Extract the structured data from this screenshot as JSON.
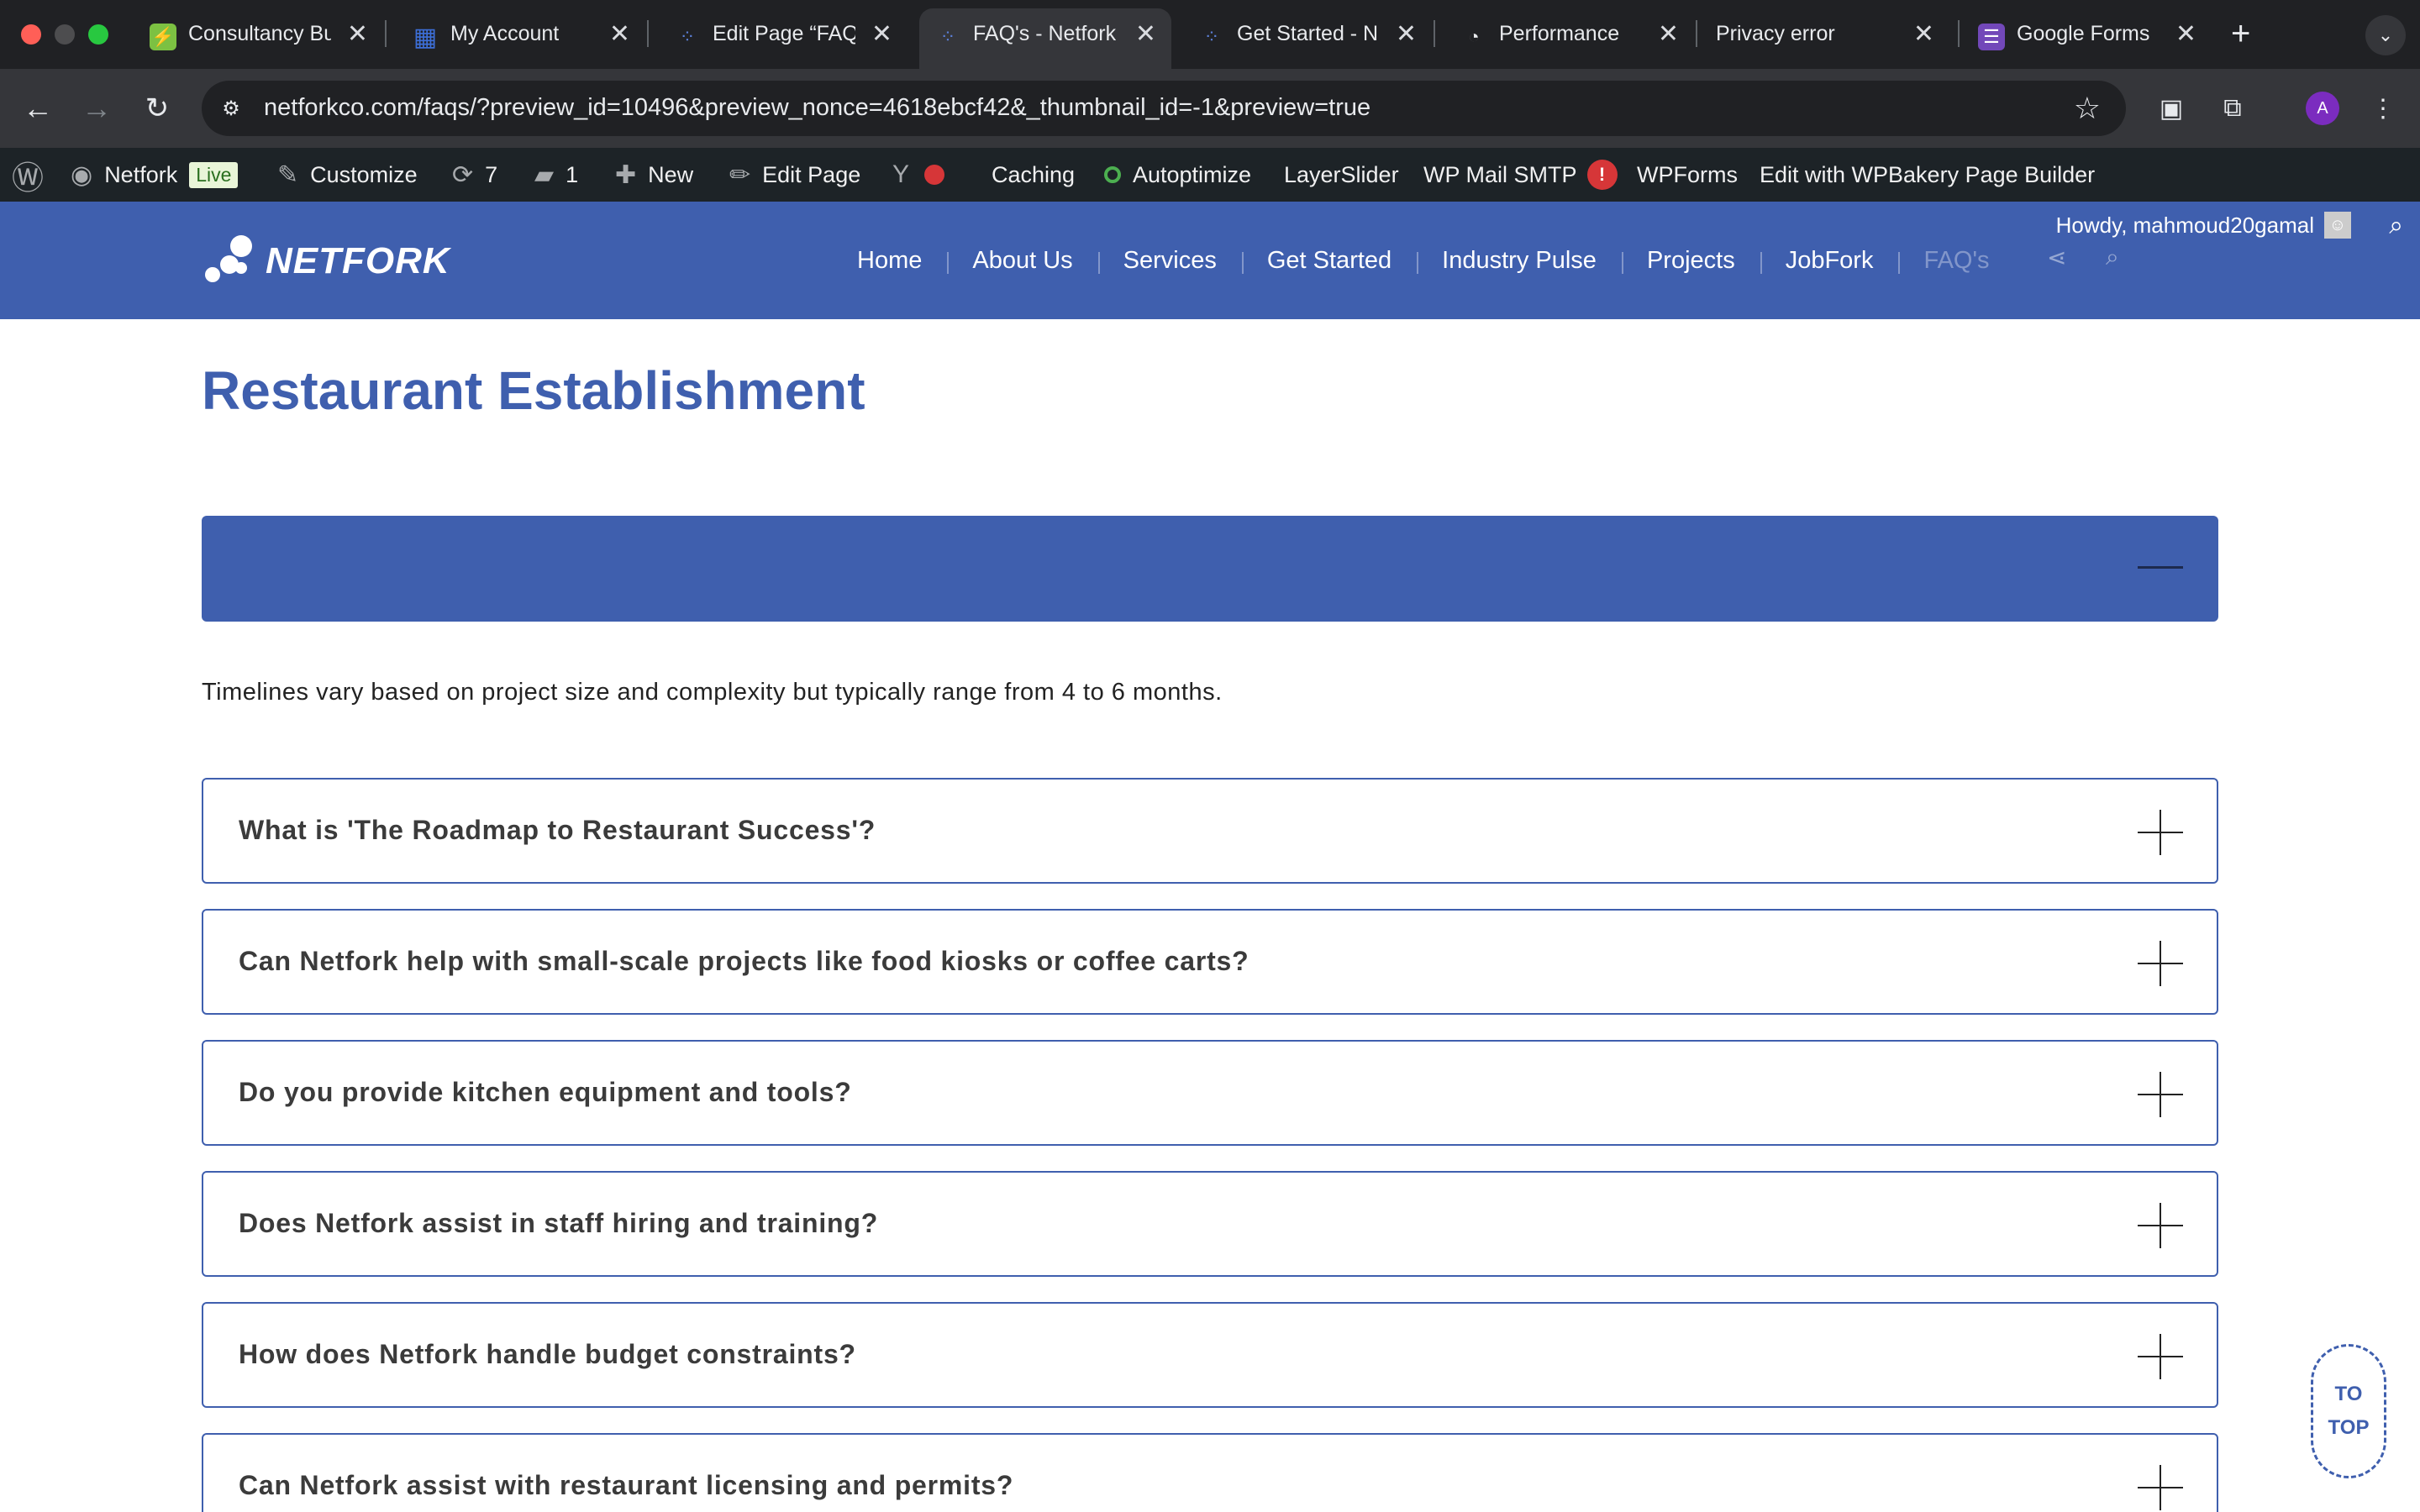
{
  "browser": {
    "tabs": [
      {
        "title": "Consultancy Bu",
        "favicon": "leaf-icon",
        "favicon_color": "#7cc142"
      },
      {
        "title": "My Account",
        "favicon": "grid-icon",
        "favicon_color": "#3d6fd8"
      },
      {
        "title": "Edit Page “FAQ",
        "favicon": "netfork-icon",
        "favicon_color": "#5b7fd6"
      },
      {
        "title": "FAQ's - Netfork",
        "favicon": "netfork-icon",
        "favicon_color": "#5b7fd6",
        "active": true
      },
      {
        "title": "Get Started - N",
        "favicon": "netfork-icon",
        "favicon_color": "#5b7fd6"
      },
      {
        "title": "Performance",
        "favicon": "gauge-icon",
        "favicon_color": "#e8eaed"
      },
      {
        "title": "Privacy error",
        "favicon": "",
        "favicon_color": ""
      },
      {
        "title": "Google Forms",
        "favicon": "forms-icon",
        "favicon_color": "#7248b9"
      }
    ],
    "close_glyph": "✕",
    "new_tab_glyph": "+",
    "url": "netforkco.com/faqs/?preview_id=10496&preview_nonce=4618ebcf42&_thumbnail_id=-1&preview=true",
    "profile_initial": "A"
  },
  "adminbar": {
    "site_name": "Netfork",
    "live_label": "Live",
    "customize": "Customize",
    "updates_count": "7",
    "comments_count": "1",
    "new_label": "New",
    "edit_page": "Edit Page",
    "caching": "Caching",
    "autoptimize": "Autoptimize",
    "layerslider": "LayerSlider",
    "wp_mail_smtp": "WP Mail SMTP",
    "wp_mail_alert": "!",
    "wpforms": "WPForms",
    "wpbakery": "Edit with WPBakery Page Builder",
    "howdy": "Howdy, mahmoud20gamal"
  },
  "site": {
    "logo_text": "NETFORK",
    "menu": [
      "Home",
      "About Us",
      "Services",
      "Get Started",
      "Industry Pulse",
      "Projects",
      "JobFork",
      "FAQ's"
    ],
    "current_menu_item": "FAQ's"
  },
  "page": {
    "title_light": "Restaurant",
    "title_bold": "Establishment",
    "open_answer": "Timelines vary based on project size and complexity but typically range from 4 to 6 months.",
    "questions": [
      "What is 'The Roadmap to Restaurant Success'?",
      "Can Netfork help with small-scale projects like food kiosks or coffee carts?",
      "Do you provide kitchen equipment and tools?",
      "Does Netfork assist in staff hiring and training?",
      "How does Netfork handle budget constraints?",
      "Can Netfork assist with restaurant licensing and permits?"
    ],
    "to_top_line1": "TO",
    "to_top_line2": "TOP"
  },
  "colors": {
    "brand_blue": "#3f5fae",
    "admin_bar": "#1d2327",
    "chrome_dark": "#202124"
  }
}
